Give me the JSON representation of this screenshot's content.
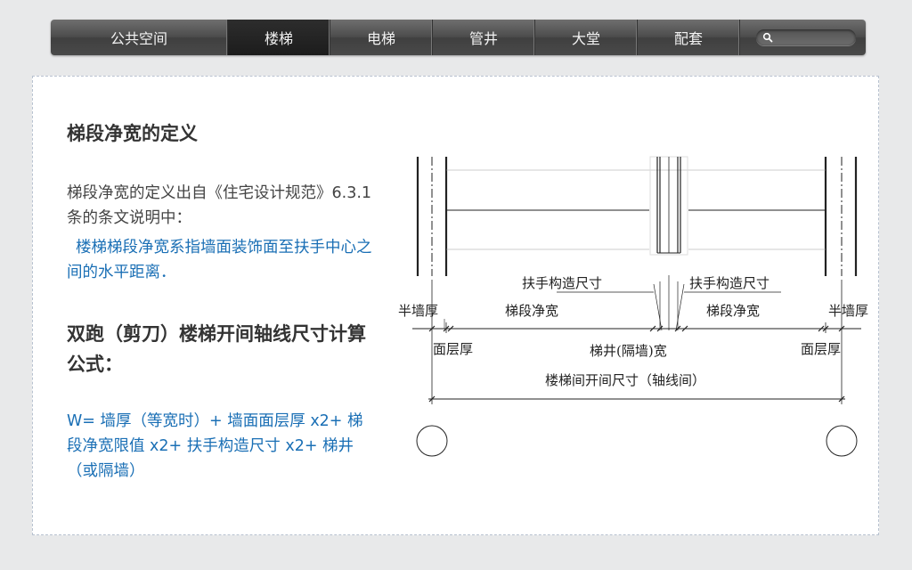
{
  "nav": {
    "items": [
      "公共空间",
      "楼梯",
      "电梯",
      "管井",
      "大堂",
      "配套"
    ],
    "active_index": 1,
    "search_placeholder": ""
  },
  "content": {
    "heading1": "梯段净宽的定义",
    "para1": "梯段净宽的定义出自《住宅设计规范》6.3.1 条的条文说明中：",
    "para2": "楼梯梯段净宽系指墙面装饰面至扶手中心之间的水平距离．",
    "heading2": "双跑（剪刀）楼梯开间轴线尺寸计算公式：",
    "formula": "W= 墙厚（等宽时）+ 墙面面层厚 x2+ 梯段净宽限值 x2+ 扶手构造尺寸 x2+ 梯井（或隔墙）"
  },
  "diagram": {
    "label_handrail_left": "扶手构造尺寸",
    "label_handrail_right": "扶手构造尺寸",
    "label_half_wall_left": "半墙厚",
    "label_half_wall_right": "半墙厚",
    "label_flight_width_left": "梯段净宽",
    "label_flight_width_right": "梯段净宽",
    "label_finish_left": "面层厚",
    "label_finish_right": "面层厚",
    "label_well": "梯井(隔墙)宽",
    "label_bay": "楼梯间开间尺寸（轴线间）"
  },
  "colors": {
    "accent_blue": "#1a6fb5",
    "nav_dark": "#3f3f3f",
    "nav_active": "#1c1c1c"
  }
}
